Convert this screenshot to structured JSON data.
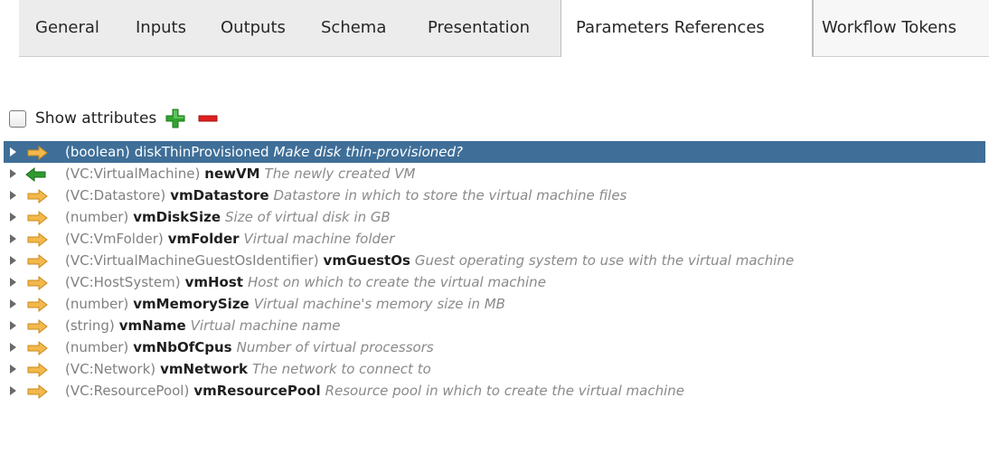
{
  "tabs": [
    {
      "label": "General",
      "active": false
    },
    {
      "label": "Inputs",
      "active": false
    },
    {
      "label": "Outputs",
      "active": false
    },
    {
      "label": "Schema",
      "active": false
    },
    {
      "label": "Presentation",
      "active": false
    },
    {
      "label": "Parameters References",
      "active": true
    },
    {
      "label": "Workflow Tokens",
      "active": false
    }
  ],
  "toolbar": {
    "show_attributes_label": "Show attributes",
    "show_attributes_checked": false,
    "add_icon": "plus-icon",
    "remove_icon": "minus-icon",
    "add_color": "#2fa52f",
    "remove_color": "#e02020"
  },
  "colors": {
    "selection": "#3f6f98",
    "input_arrow": "#f2b84b",
    "output_arrow": "#2f9a2f"
  },
  "parameters": [
    {
      "type": "(boolean)",
      "name": "diskThinProvisioned",
      "description": "Make disk thin-provisioned?",
      "direction": "input",
      "selected": true
    },
    {
      "type": "(VC:VirtualMachine)",
      "name": "newVM",
      "description": "The newly created VM",
      "direction": "output",
      "selected": false
    },
    {
      "type": "(VC:Datastore)",
      "name": "vmDatastore",
      "description": "Datastore in which to store the virtual machine files",
      "direction": "input",
      "selected": false
    },
    {
      "type": "(number)",
      "name": "vmDiskSize",
      "description": "Size of virtual disk in GB",
      "direction": "input",
      "selected": false
    },
    {
      "type": "(VC:VmFolder)",
      "name": "vmFolder",
      "description": "Virtual machine folder",
      "direction": "input",
      "selected": false
    },
    {
      "type": "(VC:VirtualMachineGuestOsIdentifier)",
      "name": "vmGuestOs",
      "description": "Guest operating system to use with the virtual machine",
      "direction": "input",
      "selected": false
    },
    {
      "type": "(VC:HostSystem)",
      "name": "vmHost",
      "description": "Host on which to create the virtual machine",
      "direction": "input",
      "selected": false
    },
    {
      "type": "(number)",
      "name": "vmMemorySize",
      "description": "Virtual machine's memory size in MB",
      "direction": "input",
      "selected": false
    },
    {
      "type": "(string)",
      "name": "vmName",
      "description": "Virtual machine name",
      "direction": "input",
      "selected": false
    },
    {
      "type": "(number)",
      "name": "vmNbOfCpus",
      "description": "Number of virtual processors",
      "direction": "input",
      "selected": false
    },
    {
      "type": "(VC:Network)",
      "name": "vmNetwork",
      "description": "The network to connect to",
      "direction": "input",
      "selected": false
    },
    {
      "type": "(VC:ResourcePool)",
      "name": "vmResourcePool",
      "description": "Resource pool in which to create the virtual machine",
      "direction": "input",
      "selected": false
    }
  ]
}
